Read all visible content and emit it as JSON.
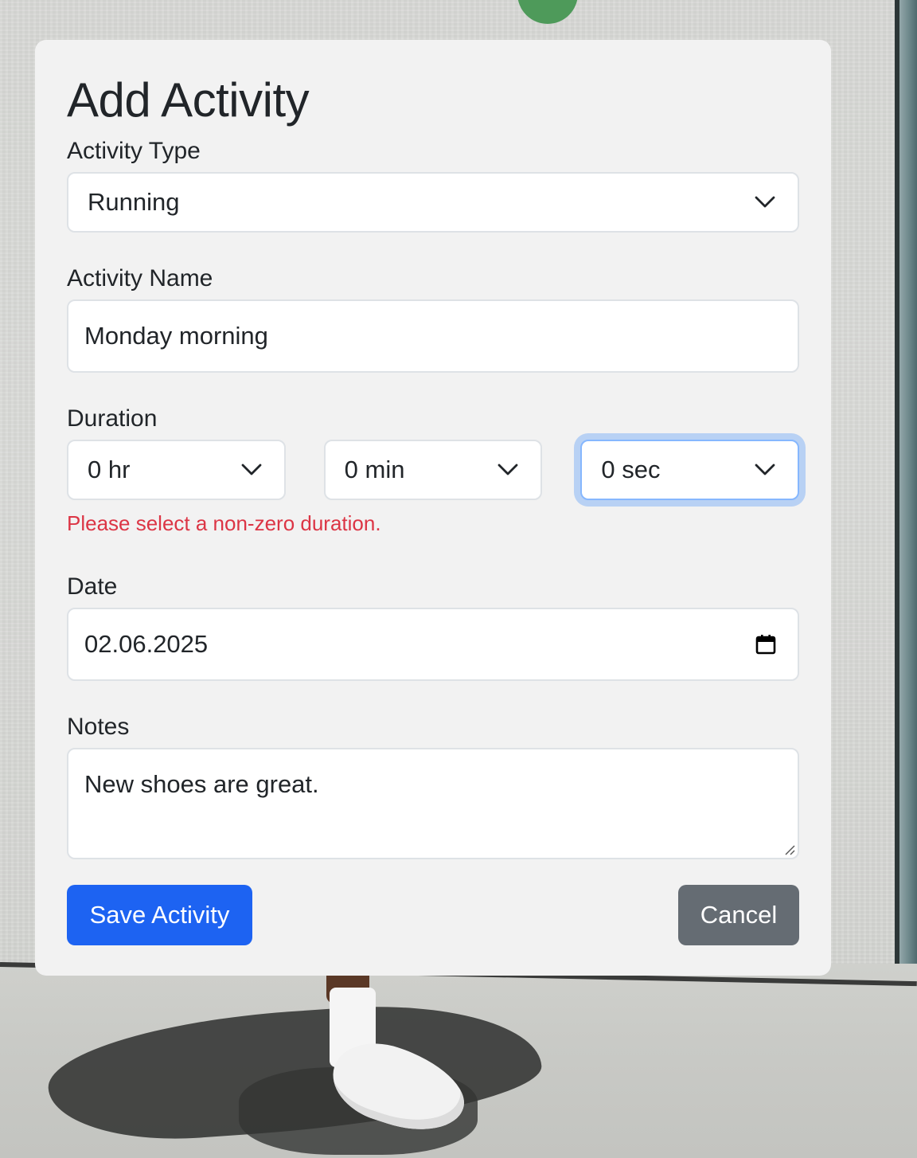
{
  "form": {
    "title": "Add Activity",
    "activity_type": {
      "label": "Activity Type",
      "value": "Running"
    },
    "activity_name": {
      "label": "Activity Name",
      "value": "Monday morning"
    },
    "duration": {
      "label": "Duration",
      "hours": "0 hr",
      "minutes": "0 min",
      "seconds": "0 sec",
      "error": "Please select a non-zero duration."
    },
    "date": {
      "label": "Date",
      "value": "02.06.2025"
    },
    "notes": {
      "label": "Notes",
      "value": "New shoes are great."
    },
    "save_label": "Save Activity",
    "cancel_label": "Cancel"
  },
  "colors": {
    "primary": "#1d63f2",
    "secondary": "#656c73",
    "error": "#dc3545",
    "focus_ring": "#86b7fe",
    "card": "#f2f2f2"
  },
  "icons": [
    "chevron-down-icon",
    "calendar-icon",
    "resize-handle-icon"
  ]
}
